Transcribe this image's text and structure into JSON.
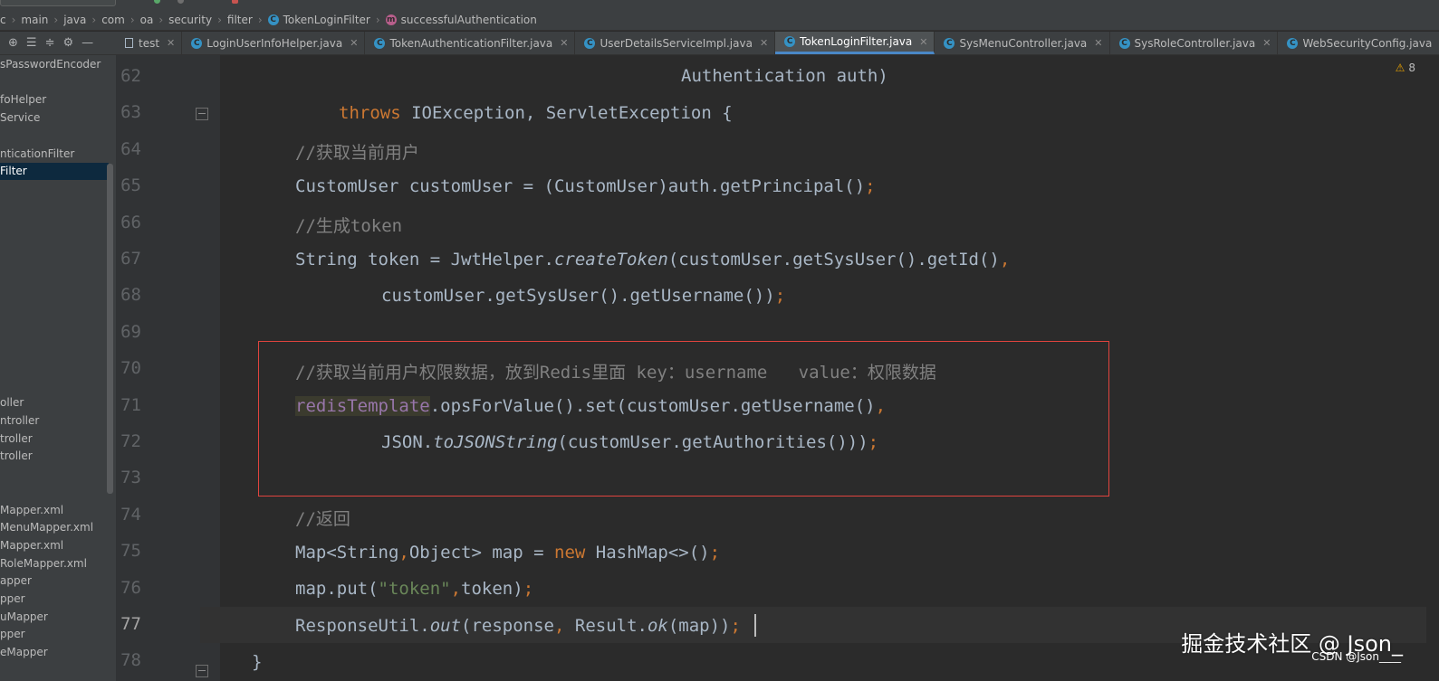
{
  "breadcrumb": [
    "c",
    "main",
    "java",
    "com",
    "oa",
    "security",
    "filter",
    "TokenLoginFilter",
    "successfulAuthentication"
  ],
  "toolbar_icons": [
    "crosshair-icon",
    "expand-all-icon",
    "collapse-all-icon",
    "gear-icon",
    "minimize-icon"
  ],
  "tabs": [
    {
      "label": "test",
      "type": "file"
    },
    {
      "label": "LoginUserInfoHelper.java",
      "type": "class"
    },
    {
      "label": "TokenAuthenticationFilter.java",
      "type": "class"
    },
    {
      "label": "UserDetailsServiceImpl.java",
      "type": "class"
    },
    {
      "label": "TokenLoginFilter.java",
      "type": "class",
      "active": true
    },
    {
      "label": "SysMenuController.java",
      "type": "class"
    },
    {
      "label": "SysRoleController.java",
      "type": "class"
    },
    {
      "label": "WebSecurityConfig.java",
      "type": "class"
    }
  ],
  "sidebar": [
    "sPasswordEncoder",
    "",
    "foHelper",
    "Service",
    "",
    "nticationFilter",
    "Filter",
    "",
    "",
    "",
    "",
    "",
    "",
    "",
    "",
    "",
    "",
    "",
    "",
    "oller",
    "ntroller",
    "troller",
    "troller",
    "",
    "",
    "Mapper.xml",
    "MenuMapper.xml",
    "Mapper.xml",
    "RoleMapper.xml",
    "apper",
    "pper",
    "uMapper",
    "pper",
    "eMapper"
  ],
  "sidebar_selected": 6,
  "editor": {
    "warnings": "8",
    "line_numbers": [
      "62",
      "63",
      "64",
      "65",
      "66",
      "67",
      "68",
      "69",
      "70",
      "71",
      "72",
      "73",
      "74",
      "75",
      "76",
      "77",
      "78"
    ],
    "current_line": "77"
  },
  "code": {
    "l62": "Authentication auth)",
    "l63_kw": "throws",
    "l63_rest": " IOException, ServletException {",
    "l64": "//获取当前用户",
    "l65_a": "CustomUser customUser = (CustomUser)auth.getPrincipal()",
    "l65_semi": ";",
    "l66": "//生成token",
    "l67_a": "String token = JwtHelper.",
    "l67_fn": "createToken",
    "l67_b": "(customUser.getSysUser().getId()",
    "l67_comma": ",",
    "l68_a": "customUser.getSysUser().getUsername())",
    "l68_semi": ";",
    "l70": "//获取当前用户权限数据，放到Redis里面 key：username   value：权限数据",
    "l71_fld": "redisTemplate",
    "l71_a": ".opsForValue().set(customUser.getUsername()",
    "l71_comma": ",",
    "l72_a": "JSON.",
    "l72_fn": "toJSONString",
    "l72_b": "(customUser.getAuthorities()))",
    "l72_semi": ";",
    "l74": "//返回",
    "l75_a": "Map<String",
    "l75_comma": ",",
    "l75_b": "Object> map = ",
    "l75_kw": "new",
    "l75_c": " HashMap<>()",
    "l75_semi": ";",
    "l76_a": "map.put(",
    "l76_str": "\"token\"",
    "l76_comma": ",",
    "l76_b": "token)",
    "l76_semi": ";",
    "l77_a": "ResponseUtil.",
    "l77_fn": "out",
    "l77_b": "(response",
    "l77_comma": ",",
    "l77_c": " Result.",
    "l77_fn2": "ok",
    "l77_d": "(map))",
    "l77_semi": ";",
    "l78": "}"
  },
  "watermark": "掘金技术社区 @ Json_",
  "watermark_small": "CSDN @Json____"
}
